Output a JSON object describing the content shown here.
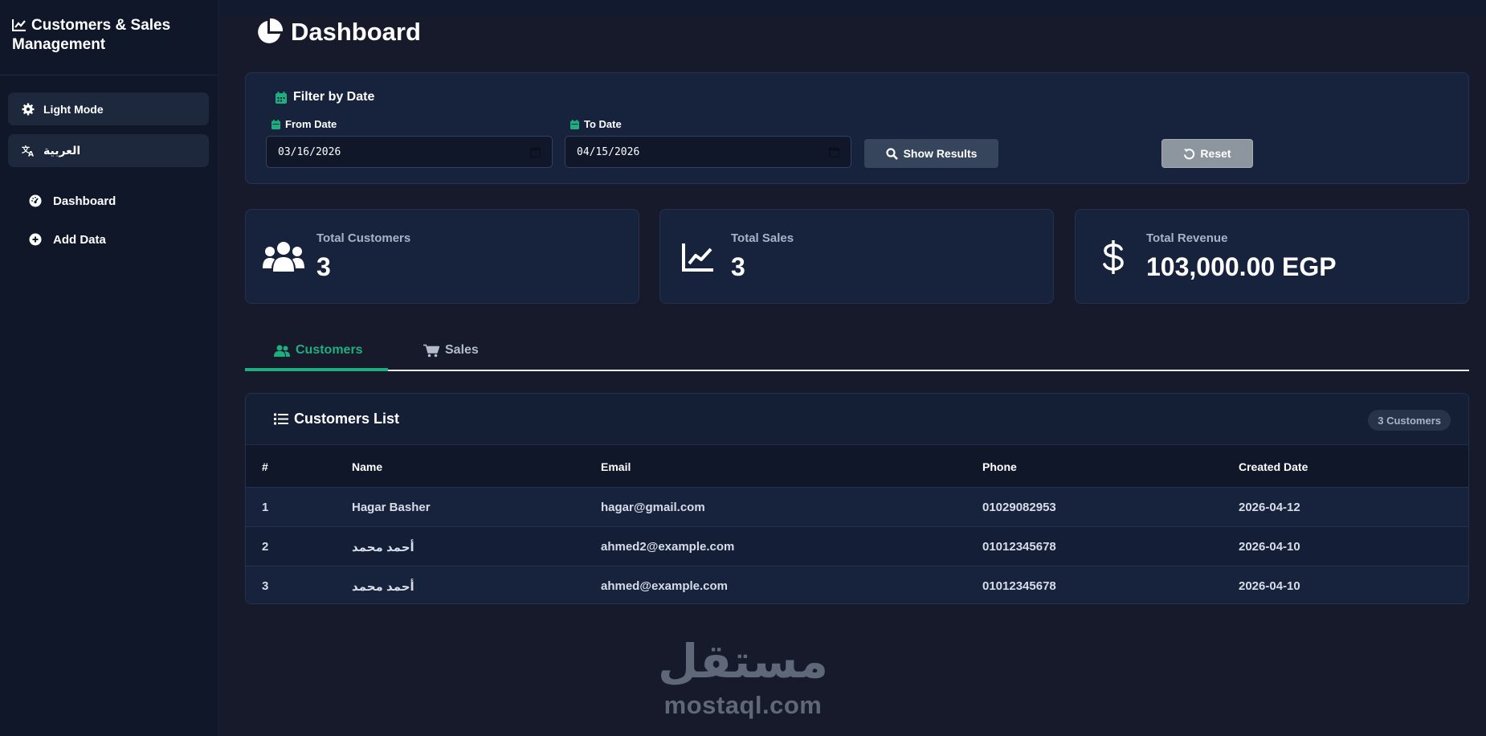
{
  "sidebar": {
    "brand": "Customers & Sales Management",
    "light_mode": "Light Mode",
    "language": "العربية",
    "nav": [
      {
        "label": "Dashboard"
      },
      {
        "label": "Add Data"
      }
    ]
  },
  "page": {
    "title": "Dashboard"
  },
  "filter": {
    "title": "Filter by Date",
    "from_label": "From Date",
    "from_value": "03/16/2026",
    "to_label": "To Date",
    "to_value": "04/15/2026",
    "show_results": "Show Results",
    "reset": "Reset"
  },
  "stats": [
    {
      "label": "Total Customers",
      "value": "3",
      "icon": "users-icon"
    },
    {
      "label": "Total Sales",
      "value": "3",
      "icon": "chart-line-icon"
    },
    {
      "label": "Total Revenue",
      "value": "103,000.00 EGP",
      "icon": "dollar-icon"
    }
  ],
  "tabs": [
    {
      "label": "Customers",
      "active": true
    },
    {
      "label": "Sales",
      "active": false
    }
  ],
  "customers_list": {
    "title": "Customers List",
    "count_badge": "3 Customers",
    "columns": [
      "#",
      "Name",
      "Email",
      "Phone",
      "Created Date"
    ],
    "rows": [
      [
        "1",
        "Hagar Basher",
        "hagar@gmail.com",
        "01029082953",
        "2026-04-12"
      ],
      [
        "2",
        "أحمد محمد",
        "ahmed2@example.com",
        "01012345678",
        "2026-04-10"
      ],
      [
        "3",
        "أحمد محمد",
        "ahmed@example.com",
        "01012345678",
        "2026-04-10"
      ]
    ]
  },
  "watermark": {
    "arabic": "مستقل",
    "latin": "mostaql.com"
  },
  "colors": {
    "accent": "#1fae7d",
    "background": "#111a2e",
    "card": "#17233d",
    "reset_button": "#8d969f",
    "show_button": "#36455c"
  }
}
